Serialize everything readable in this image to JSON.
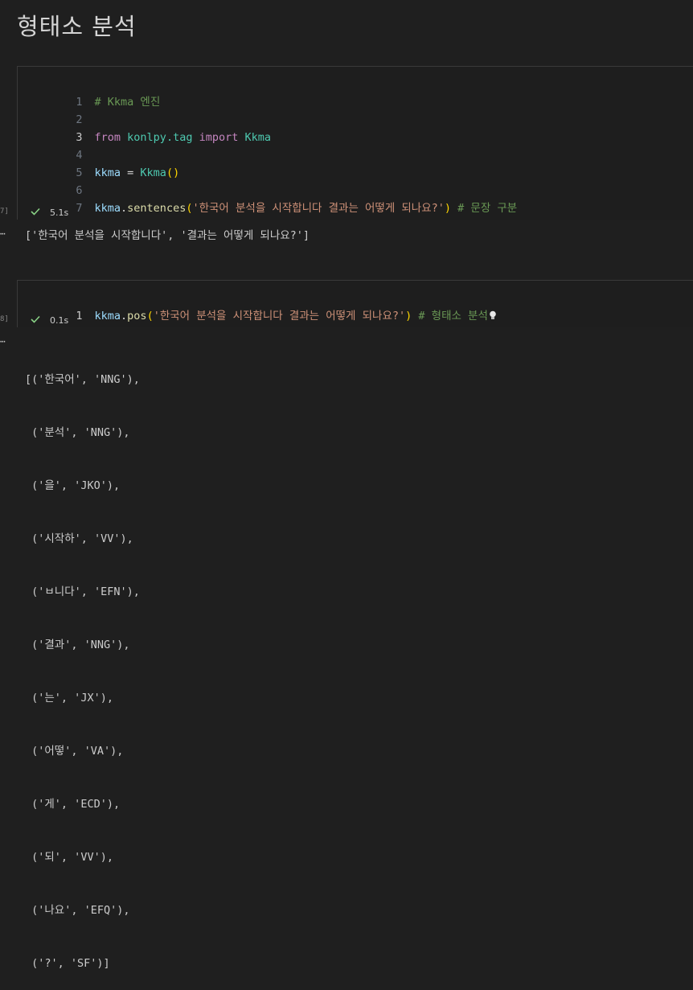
{
  "heading": "형태소 분석",
  "cell1": {
    "exec_count": "7]",
    "lines": [
      {
        "num": "1",
        "comment": "# Kkma 엔진"
      },
      {
        "num": "2"
      },
      {
        "num": "3",
        "kw_from": "from",
        "module": "konlpy.tag",
        "kw_import": "import",
        "cls": "Kkma"
      },
      {
        "num": "4"
      },
      {
        "num": "5",
        "var": "kkma",
        "op": " = ",
        "cls": "Kkma",
        "paren_open": "(",
        "paren_close": ")"
      },
      {
        "num": "6"
      },
      {
        "num": "7",
        "var": "kkma",
        "dot": ".",
        "fn": "sentences",
        "paren_open": "(",
        "str": "'한국어 분석을 시작합니다 결과는 어떻게 되나요?'",
        "paren_close": ")",
        "comment": " # 문장 구분"
      }
    ],
    "status_time": "5.1s",
    "output": "['한국어 분석을 시작합니다', '결과는 어떻게 되나요?']"
  },
  "cell2": {
    "exec_count": "8]",
    "line": {
      "num": "1",
      "var": "kkma",
      "dot": ".",
      "fn": "pos",
      "paren_open": "(",
      "str": "'한국어 분석을 시작합니다 결과는 어떻게 되나요?'",
      "paren_close": ")",
      "comment": " # 형태소 분석"
    },
    "status_time": "0.1s",
    "output_lines": [
      "[('한국어', 'NNG'),",
      " ('분석', 'NNG'),",
      " ('을', 'JKO'),",
      " ('시작하', 'VV'),",
      " ('ㅂ니다', 'EFN'),",
      " ('결과', 'NNG'),",
      " ('는', 'JX'),",
      " ('어떻', 'VA'),",
      " ('게', 'ECD'),",
      " ('되', 'VV'),",
      " ('나요', 'EFQ'),",
      " ('?', 'SF')]"
    ]
  },
  "icons": {
    "check": "check-icon",
    "bulb": "lightbulb-icon",
    "more": "more-dots-icon"
  },
  "out_marker": "⋯"
}
